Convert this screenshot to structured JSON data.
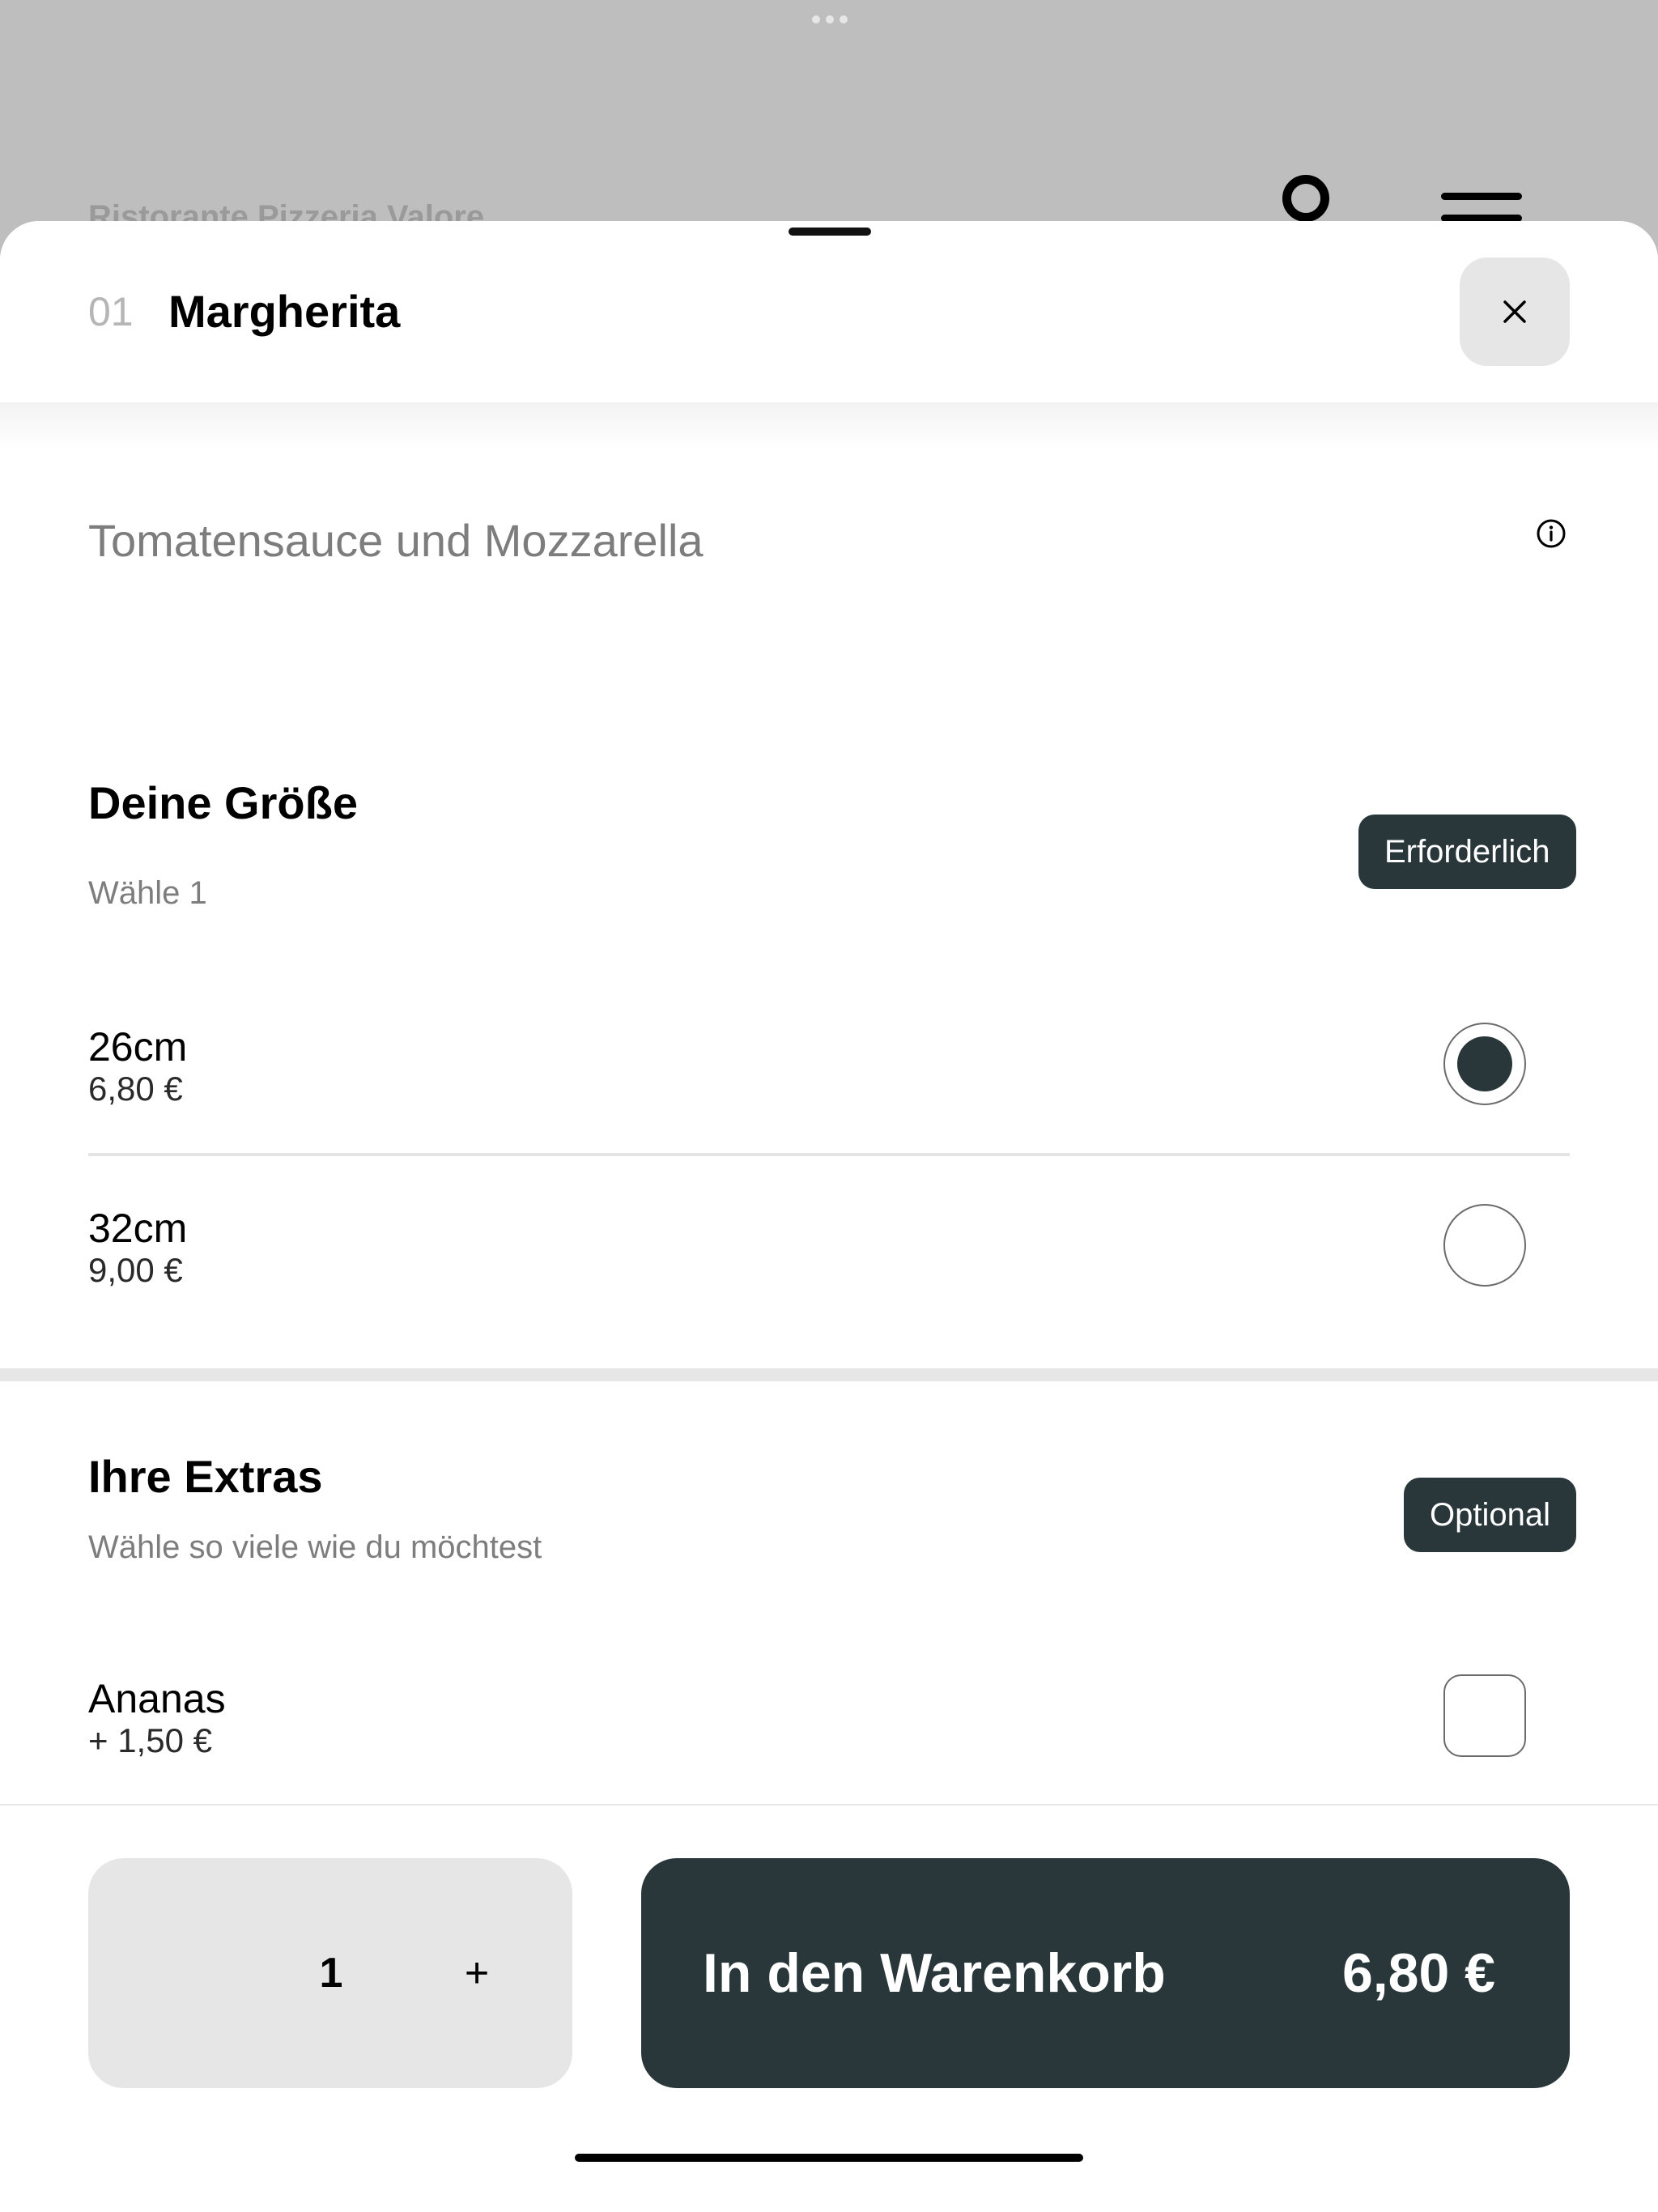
{
  "background": {
    "restaurant_name": "Ristorante Pizzeria Valore",
    "icons": {
      "user": "user-icon",
      "menu": "menu-icon"
    }
  },
  "header": {
    "item_number": "01",
    "item_title": "Margherita",
    "close_label": "×"
  },
  "description": "Tomatensauce und Mozzarella",
  "size_section": {
    "title": "Deine Größe",
    "subtitle": "Wähle 1",
    "badge": "Erforderlich",
    "options": [
      {
        "name": "26cm",
        "price": "6,80 €",
        "selected": true
      },
      {
        "name": "32cm",
        "price": "9,00 €",
        "selected": false
      }
    ]
  },
  "extras_section": {
    "title": "Ihre Extras",
    "subtitle": "Wähle so viele wie du möchtest",
    "badge": "Optional",
    "options": [
      {
        "name": "Ananas",
        "price": "+ 1,50 €",
        "checked": false
      }
    ]
  },
  "footer": {
    "quantity": "1",
    "plus_label": "+",
    "add_to_cart_label": "In den Warenkorb",
    "total_price": "6,80 €"
  },
  "colors": {
    "accent": "#29373a",
    "muted_text": "#7d7d7d",
    "button_bg": "#e6e6e6"
  }
}
